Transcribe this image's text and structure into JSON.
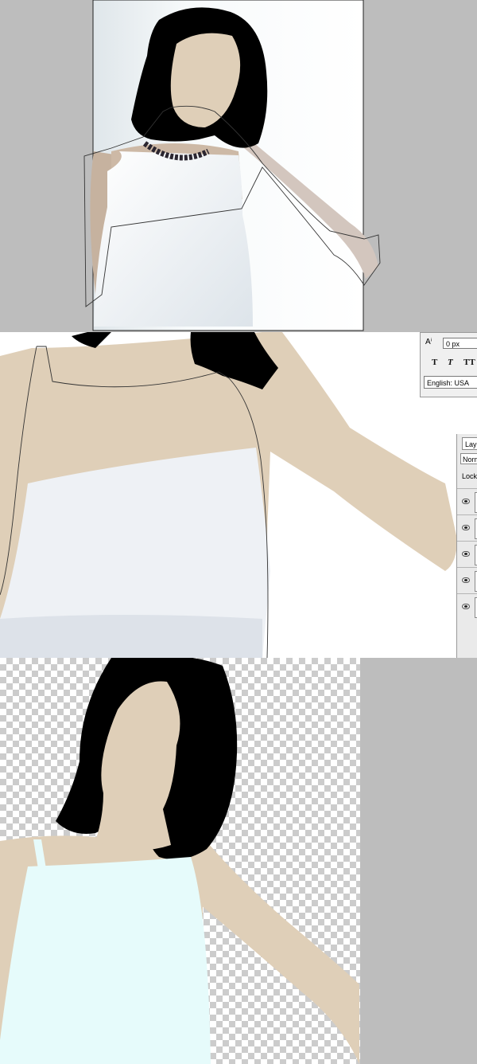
{
  "character_panel": {
    "tracking_value": "0 px",
    "style_buttons": [
      "T",
      "T",
      "TT"
    ],
    "language": "English: USA"
  },
  "layers_panel": {
    "tab_label": "Lay",
    "blend_mode": "Norm",
    "lock_label": "Lock",
    "layer_count": 5
  },
  "colors": {
    "skin": "#dfcfb8",
    "hair": "#000000",
    "shirt_fill": "#e6fbfb",
    "canvas_bg": "#bdbdbd",
    "path_stroke": "#333333"
  },
  "icons": [
    "eye-icon",
    "character-tracking-icon"
  ]
}
